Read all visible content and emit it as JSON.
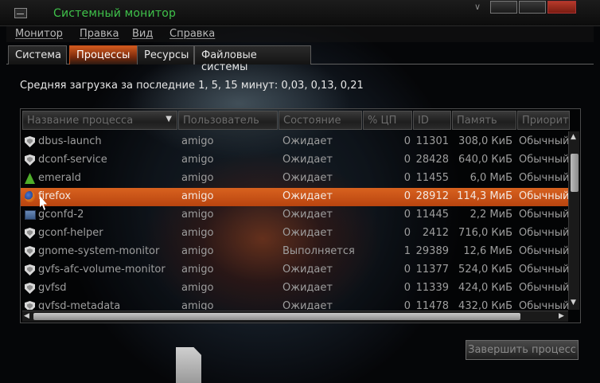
{
  "window": {
    "title": "Системный монитор"
  },
  "menu": [
    "Монитор",
    "Правка",
    "Вид",
    "Справка"
  ],
  "tabs": [
    {
      "label": "Система",
      "active": false
    },
    {
      "label": "Процессы",
      "active": true
    },
    {
      "label": "Ресурсы",
      "active": false
    },
    {
      "label": "Файловые системы",
      "active": false
    }
  ],
  "load_average": "Средняя загрузка за последние 1, 5, 15 минут: 0,03, 0,13, 0,21",
  "columns": [
    "Название процесса",
    "Пользователь",
    "Состояние",
    "% ЦП",
    "ID",
    "Память",
    "Приорит"
  ],
  "processes": [
    {
      "icon": "shield-icon",
      "name": "dbus-launch",
      "user": "amigo",
      "state": "Ожидает",
      "cpu": "0",
      "id": "11301",
      "memory": "308,0 КиБ",
      "priority": "Обычный"
    },
    {
      "icon": "shield-icon",
      "name": "dconf-service",
      "user": "amigo",
      "state": "Ожидает",
      "cpu": "0",
      "id": "28428",
      "memory": "640,0 КиБ",
      "priority": "Обычный"
    },
    {
      "icon": "emerald-icon",
      "name": "emerald",
      "user": "amigo",
      "state": "Ожидает",
      "cpu": "0",
      "id": "11455",
      "memory": "6,0 МиБ",
      "priority": "Обычный"
    },
    {
      "icon": "firefox-icon",
      "name": "firefox",
      "user": "amigo",
      "state": "Ожидает",
      "cpu": "0",
      "id": "28912",
      "memory": "114,3 МиБ",
      "priority": "Обычный",
      "selected": true
    },
    {
      "icon": "gconf-icon",
      "name": "gconfd-2",
      "user": "amigo",
      "state": "Ожидает",
      "cpu": "0",
      "id": "11445",
      "memory": "2,2 МиБ",
      "priority": "Обычный"
    },
    {
      "icon": "shield-icon",
      "name": "gconf-helper",
      "user": "amigo",
      "state": "Ожидает",
      "cpu": "0",
      "id": "2412",
      "memory": "716,0 КиБ",
      "priority": "Обычный"
    },
    {
      "icon": "shield-icon",
      "name": "gnome-system-monitor",
      "user": "amigo",
      "state": "Выполняется",
      "cpu": "1",
      "id": "29389",
      "memory": "12,6 МиБ",
      "priority": "Обычный"
    },
    {
      "icon": "shield-icon",
      "name": "gvfs-afc-volume-monitor",
      "user": "amigo",
      "state": "Ожидает",
      "cpu": "0",
      "id": "11377",
      "memory": "524,0 КиБ",
      "priority": "Обычный"
    },
    {
      "icon": "shield-icon",
      "name": "gvfsd",
      "user": "amigo",
      "state": "Ожидает",
      "cpu": "0",
      "id": "11339",
      "memory": "424,0 КиБ",
      "priority": "Обычный"
    },
    {
      "icon": "shield-icon",
      "name": "gvfsd-metadata",
      "user": "amigo",
      "state": "Ожидает",
      "cpu": "0",
      "id": "11478",
      "memory": "432,0 КиБ",
      "priority": "Обычный"
    }
  ],
  "end_process_label": "Завершить процесс",
  "colors": {
    "title": "#3fc24a",
    "selection": "#d8621f",
    "tab_active": "#d25a1e"
  }
}
